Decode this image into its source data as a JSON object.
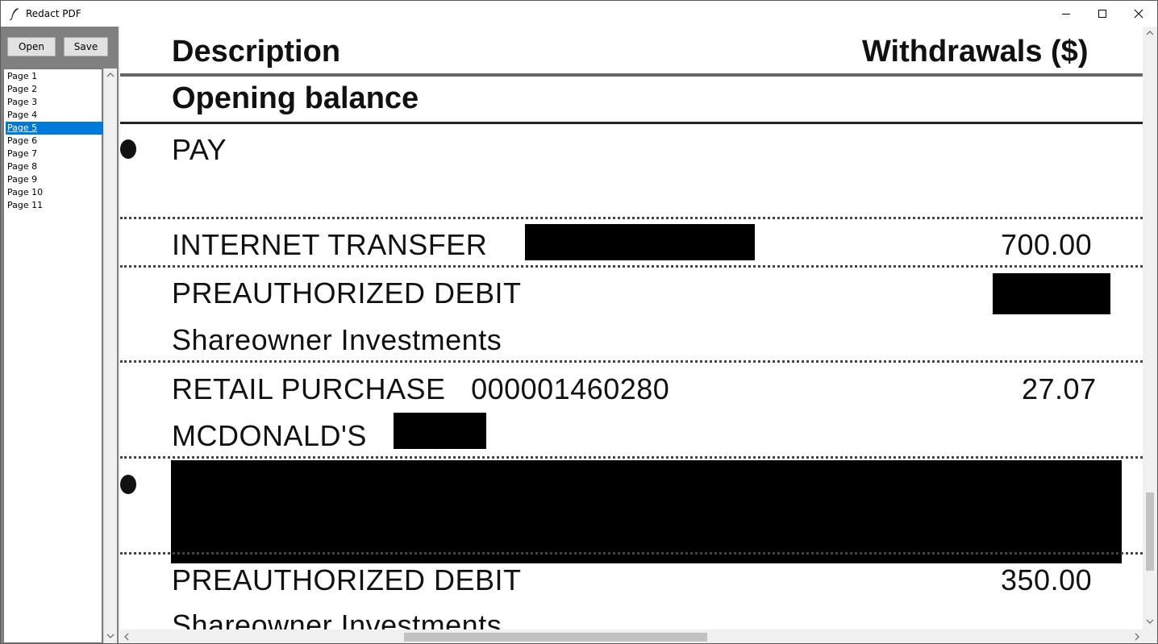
{
  "window": {
    "title": "Redact PDF"
  },
  "toolbar": {
    "open_label": "Open",
    "save_label": "Save"
  },
  "pages": {
    "items": [
      "Page 1",
      "Page 2",
      "Page 3",
      "Page 4",
      "Page 5",
      "Page 6",
      "Page 7",
      "Page 8",
      "Page 9",
      "Page 10",
      "Page 11"
    ],
    "selected": "Page 5"
  },
  "document": {
    "header_description": "Description",
    "header_withdrawals": "Withdrawals ($)",
    "opening_balance": "Opening balance",
    "row_pay": "PAY",
    "row_internet_transfer": "INTERNET TRANSFER",
    "amount_internet_transfer": "700.00",
    "row_preauth_debit_1": "PREAUTHORIZED DEBIT",
    "row_shareowner_1": "Shareowner Investments",
    "row_retail_purchase": "RETAIL PURCHASE   000001460280",
    "amount_retail_purchase": "27.07",
    "row_mcdonalds": "MCDONALD'S",
    "row_preauth_debit_2": "PREAUTHORIZED DEBIT",
    "amount_preauth_debit_2": "350.00",
    "row_shareowner_2": "Shareowner Investments"
  },
  "colors": {
    "selection": "#0078d7",
    "redaction": "#000000",
    "panel": "#808080"
  },
  "icons": [
    "feather-icon",
    "minimize-icon",
    "maximize-icon",
    "close-icon",
    "scroll-up-icon",
    "scroll-down-icon",
    "scroll-left-icon",
    "scroll-right-icon"
  ]
}
